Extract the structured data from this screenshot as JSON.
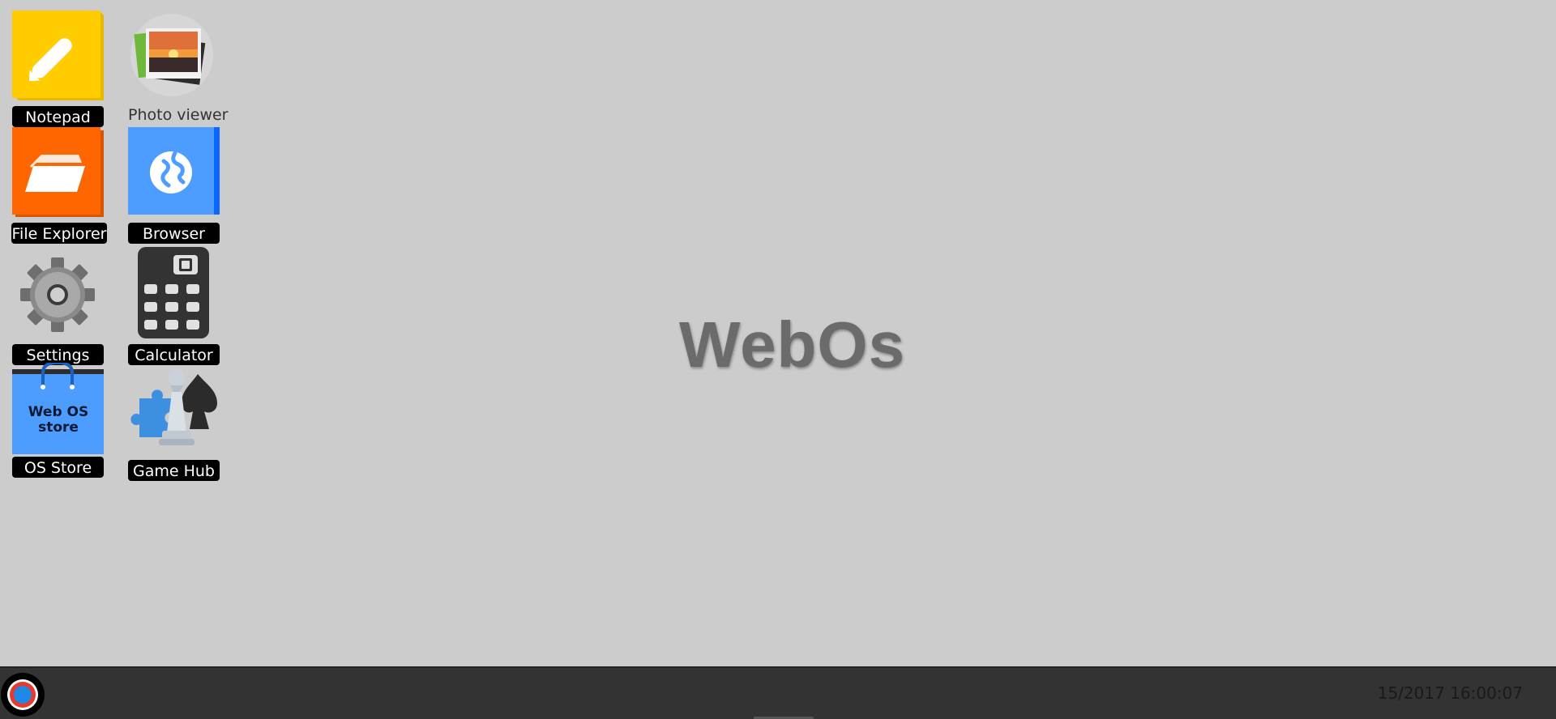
{
  "desktop": {
    "watermark": "WebOs",
    "background_color": "#cccccc",
    "icons": [
      {
        "name": "notepad",
        "label": "Notepad",
        "icon": "pencil-icon",
        "color": "#ffcc00"
      },
      {
        "name": "photo-viewer",
        "label": "Photo viewer",
        "icon": "photos-icon"
      },
      {
        "name": "file-explorer",
        "label": "File Explorer",
        "icon": "folder-icon",
        "color": "#ff6600"
      },
      {
        "name": "browser",
        "label": "Browser",
        "icon": "globe-icon",
        "color": "#4d9cff"
      },
      {
        "name": "settings",
        "label": "Settings",
        "icon": "gear-icon"
      },
      {
        "name": "calculator",
        "label": "Calculator",
        "icon": "calculator-icon"
      },
      {
        "name": "os-store",
        "label": "OS Store",
        "icon": "shopping-bag-icon",
        "bag_text": "Web OS store",
        "color": "#4d9cff"
      },
      {
        "name": "game-hub",
        "label": "Game Hub",
        "icon": "games-icon"
      }
    ]
  },
  "taskbar": {
    "start_icon": "start-orb-icon",
    "clock": "15/2017 16:00:07"
  }
}
